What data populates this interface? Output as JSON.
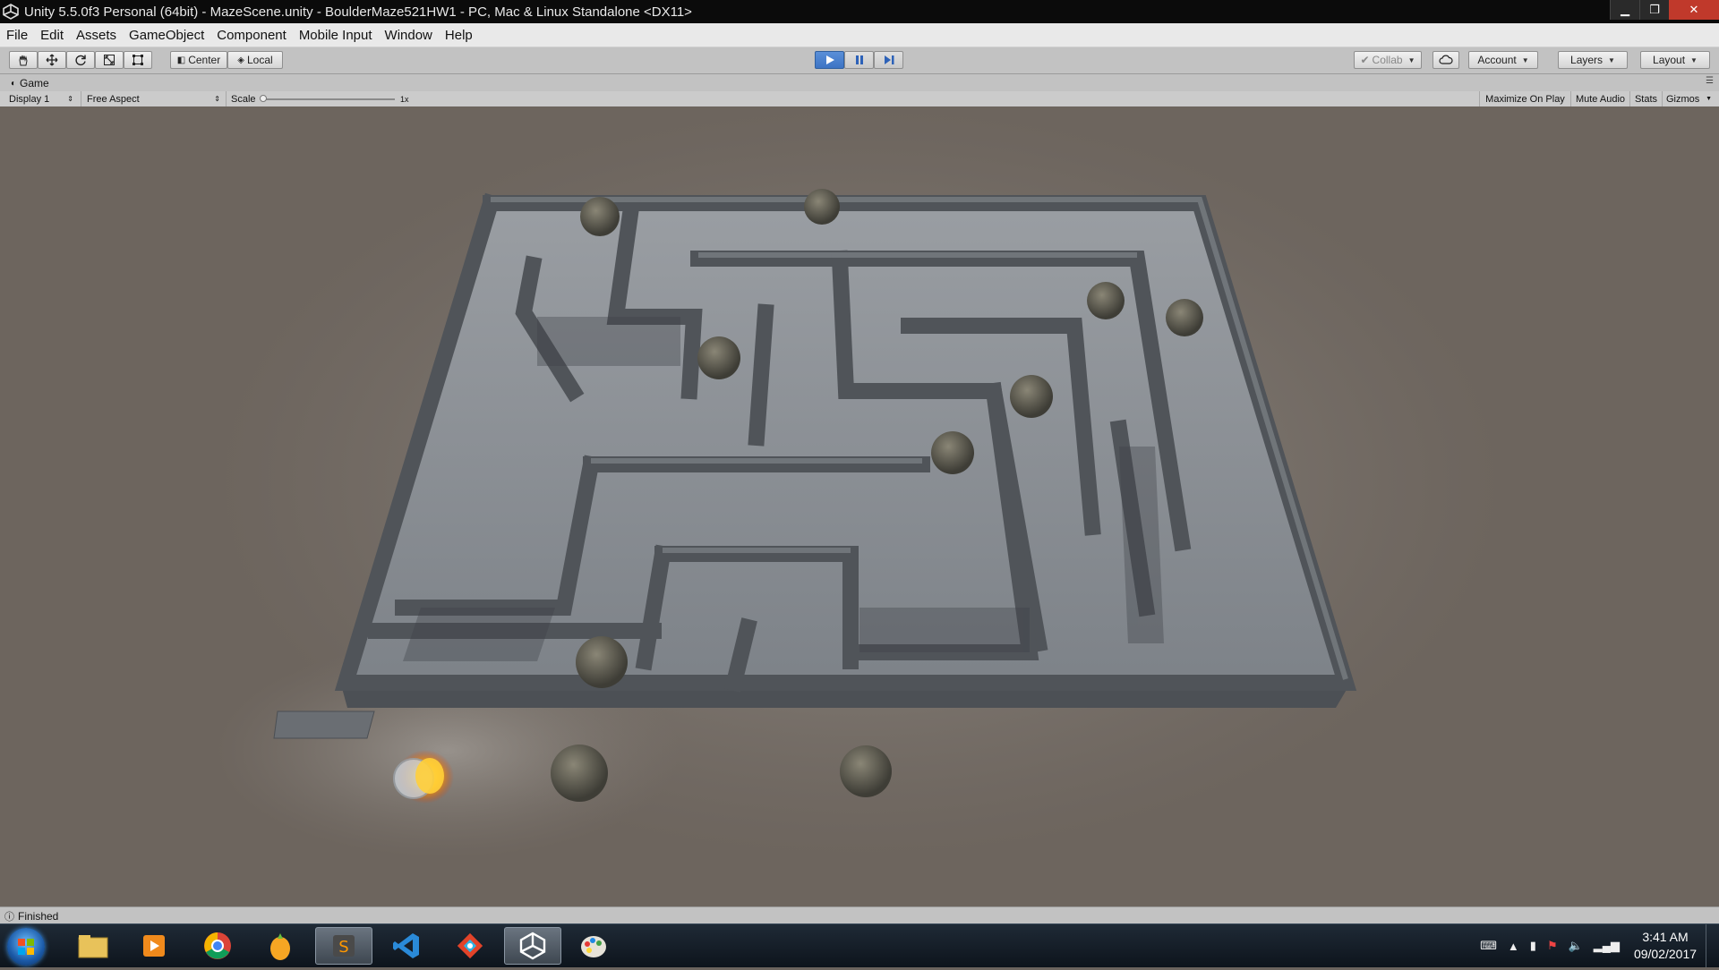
{
  "window": {
    "title": "Unity 5.5.0f3 Personal (64bit) - MazeScene.unity - BoulderMaze521HW1 - PC, Mac & Linux Standalone <DX11>",
    "min_glyph": "▁",
    "max_glyph": "❐",
    "close_glyph": "✕"
  },
  "menu": [
    "File",
    "Edit",
    "Assets",
    "GameObject",
    "Component",
    "Mobile Input",
    "Window",
    "Help"
  ],
  "toolbar": {
    "tools": [
      "hand-tool-icon",
      "move-tool-icon",
      "rotate-tool-icon",
      "scale-tool-icon",
      "rect-tool-icon"
    ],
    "pivot_label": "Center",
    "space_label": "Local",
    "collab_label": "Collab",
    "account_label": "Account",
    "layers_label": "Layers",
    "layout_label": "Layout",
    "play_active": true
  },
  "game_tab": {
    "tab_label": "Game",
    "display_label": "Display 1",
    "aspect_label": "Free Aspect",
    "scale_label": "Scale",
    "scale_value": "1x",
    "maximize_label": "Maximize On Play",
    "mute_label": "Mute Audio",
    "stats_label": "Stats",
    "gizmos_label": "Gizmos"
  },
  "status": {
    "text": "Finished"
  },
  "taskbar": {
    "apps": [
      "file-explorer-icon",
      "media-player-icon",
      "chrome-icon",
      "fl-studio-icon",
      "sublime-text-icon",
      "visual-studio-code-icon",
      "git-icon",
      "unity-icon",
      "paint-icon"
    ],
    "active_app": "unity-icon",
    "time": "3:41 AM",
    "date": "09/02/2017"
  },
  "colors": {
    "titlebar_bg": "#0b0b0b",
    "close_red": "#c0392b",
    "play_blue": "#3d74c4",
    "game_bg": "#6d655e",
    "maze_stone": "#8a8d92",
    "wall_top": "#5f6368"
  }
}
